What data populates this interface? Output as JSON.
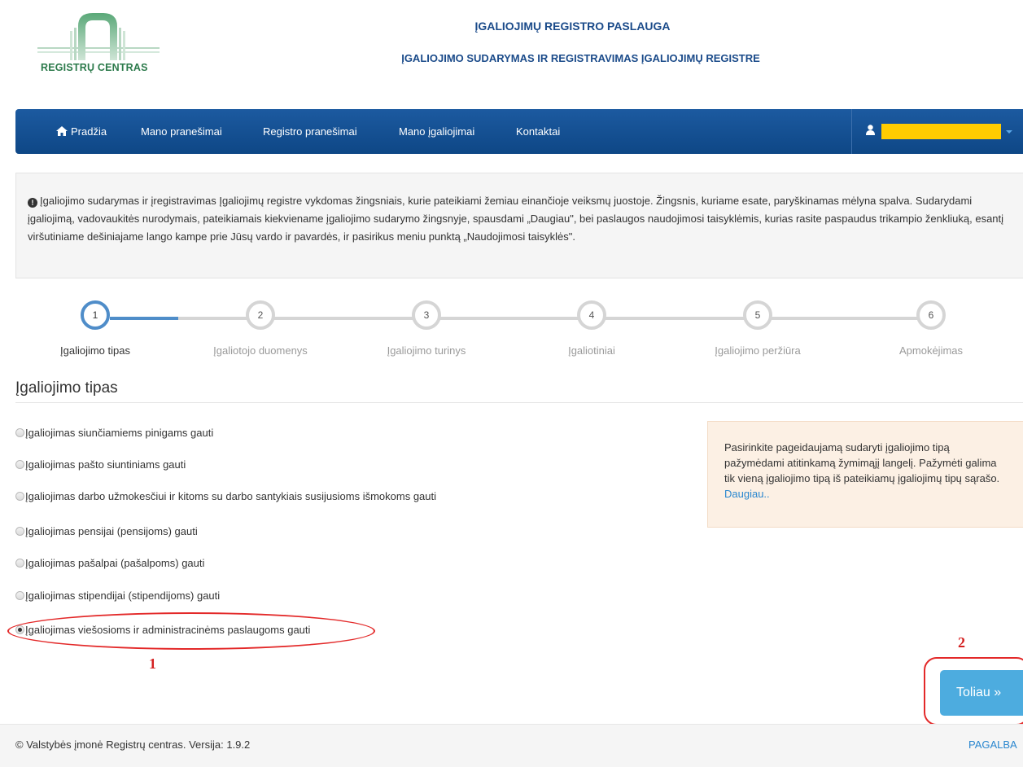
{
  "header": {
    "logo_text": "REGISTRŲ CENTRAS",
    "title": "ĮGALIOJIMŲ REGISTRO PASLAUGA",
    "subtitle": "ĮGALIOJIMO SUDARYMAS IR REGISTRAVIMAS ĮGALIOJIMŲ REGISTRE"
  },
  "nav": {
    "items": [
      "Pradžia",
      "Mano pranešimai",
      "Registro pranešimai",
      "Mano įgaliojimai",
      "Kontaktai"
    ],
    "home_icon": "home-icon",
    "user_icon": "user-icon",
    "user_name_redaction_color": "#ffcc00"
  },
  "info": {
    "text": "Įgaliojimo sudarymas ir įregistravimas Įgaliojimų registre vykdomas žingsniais, kurie pateikiami žemiau einančioje veiksmų juostoje. Žingsnis, kuriame esate, paryškinamas mėlyna spalva. Sudarydami įgaliojimą, vadovaukitės nurodymais, pateikiamais kiekviename įgaliojimo sudarymo žingsnyje, spausdami „Daugiau\", bei paslaugos naudojimosi taisyklėmis, kurias rasite paspaudus trikampio ženkliuką, esantį viršutiniame dešiniajame lango kampe prie Jūsų vardo ir pavardės, ir pasirikus meniu punktą „Naudojimosi taisyklės\"."
  },
  "steps": [
    {
      "number": "1",
      "label": "Įgaliojimo tipas",
      "active": true
    },
    {
      "number": "2",
      "label": "Įgaliotojo duomenys",
      "active": false
    },
    {
      "number": "3",
      "label": "Įgaliojimo turinys",
      "active": false
    },
    {
      "number": "4",
      "label": "Įgaliotiniai",
      "active": false
    },
    {
      "number": "5",
      "label": "Įgaliojimo peržiūra",
      "active": false
    },
    {
      "number": "6",
      "label": "Apmokėjimas",
      "active": false
    }
  ],
  "section": {
    "title": "Įgaliojimo tipas",
    "options": [
      {
        "label": "Įgaliojimas siunčiamiems pinigams gauti",
        "checked": false
      },
      {
        "label": "Įgaliojimas pašto siuntiniams gauti",
        "checked": false
      },
      {
        "label": "Įgaliojimas darbo užmokesčiui ir kitoms su darbo santykiais susijusioms išmokoms gauti",
        "checked": false
      },
      {
        "label": "Įgaliojimas pensijai (pensijoms) gauti",
        "checked": false
      },
      {
        "label": "Įgaliojimas pašalpai (pašalpoms) gauti",
        "checked": false
      },
      {
        "label": "Įgaliojimas stipendijai (stipendijoms) gauti",
        "checked": false
      },
      {
        "label": "Įgaliojimas viešosioms ir administracinėms paslaugoms gauti",
        "checked": true
      }
    ]
  },
  "help": {
    "text": "Pasirinkite pageidaujamą sudaryti įgaliojimo tipą pažymėdami atitinkamą žymimąjį langelį. Pažymėti galima tik vieną įgaliojimo tipą iš pateikiamų įgaliojimų tipų sąrašo.",
    "link": "Daugiau.."
  },
  "annotations": {
    "marker_1": "1",
    "marker_2": "2",
    "color": "#d42020"
  },
  "buttons": {
    "next": "Toliau »"
  },
  "footer": {
    "copyright": "© Valstybės įmonė Registrų centras. Versija: 1.9.2",
    "help_link": "PAGALBA"
  }
}
